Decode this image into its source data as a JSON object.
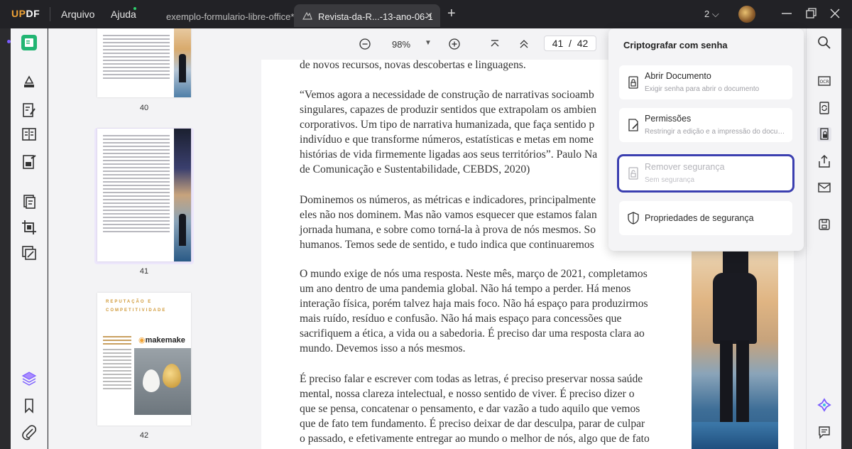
{
  "titlebar": {
    "logo_u": "UP",
    "logo_rest": "DF",
    "menu_file": "Arquivo",
    "menu_help": "Ajuda",
    "tabs": [
      {
        "label": "exemplo-formulario-libre-office*"
      },
      {
        "label": "Revista-da-R...-13-ano-06-1"
      }
    ],
    "new_tab": "+",
    "window_count": "2"
  },
  "toolbar": {
    "zoom": "98%",
    "current_page": "41",
    "page_sep": "/",
    "total_pages": "42"
  },
  "thumbnails": {
    "labels": [
      "40",
      "41",
      "42"
    ],
    "page42_heading_line1": "REPUTAÇÃO E",
    "page42_heading_line2": "COMPETITIVIDADE",
    "page42_logo": "makemake"
  },
  "document": {
    "paragraphs": [
      "de novos recursos, novas descobertas e linguagens.",
      "“Vemos agora a necessidade de construção de narrativas socioamb\nsingulares, capazes de produzir sentidos que extrapolam os ambien\ncorporativos. Um tipo de narrativa humanizada, que faça sentido p\nindivíduo e que transforme números, estatísticas e metas em nome\nhistórias de vida firmemente ligadas aos seus territórios”. Paulo Na\nde Comunicação e Sustentabilidade, CEBDS, 2020)",
      "Dominemos os números, as métricas e indicadores, principalmente\neles não nos dominem. Mas não vamos esquecer que estamos falan\njornada humana, e sobre como torná-la à prova de nós mesmos. So\nhumanos. Temos sede de sentido, e tudo indica que continuaremos",
      "O mundo exige de nós uma resposta. Neste mês, março de 2021, completamos\num ano dentro de uma pandemia global. Não há tempo a perder. Há menos\ninteração física, porém talvez haja mais foco. Não há espaço para produzirmos\nmais ruído, resíduo e confusão. Não há mais espaço para concessões que\nsacrifiquem a ética, a vida ou a sabedoria. É preciso dar uma resposta clara ao\nmundo. Devemos isso a nós mesmos.",
      "É preciso falar e escrever com todas as letras, é preciso preservar nossa saúde\nmental, nossa clareza intelectual, e nosso sentido de viver. É preciso dizer o\nque se pensa, concatenar o pensamento, e dar vazão a tudo aquilo que vemos\nque de fato tem fundamento. É preciso deixar de dar desculpa, parar de culpar\no passado, e efetivamente entregar ao mundo o melhor de nós, algo que de fato"
    ]
  },
  "popup": {
    "title": "Criptografar com senha",
    "items": [
      {
        "title": "Abrir Documento",
        "subtitle": "Exigir senha para abrir o documento"
      },
      {
        "title": "Permissões",
        "subtitle": "Restringir a edição e a impressão do documento"
      },
      {
        "title": "Remover segurança",
        "subtitle": "Sem segurança"
      },
      {
        "title": "Propriedades de segurança"
      }
    ]
  },
  "colors": {
    "accent": "#7a5cff",
    "highlight_border": "#3b3fb0",
    "logo_orange": "#f0a336"
  }
}
